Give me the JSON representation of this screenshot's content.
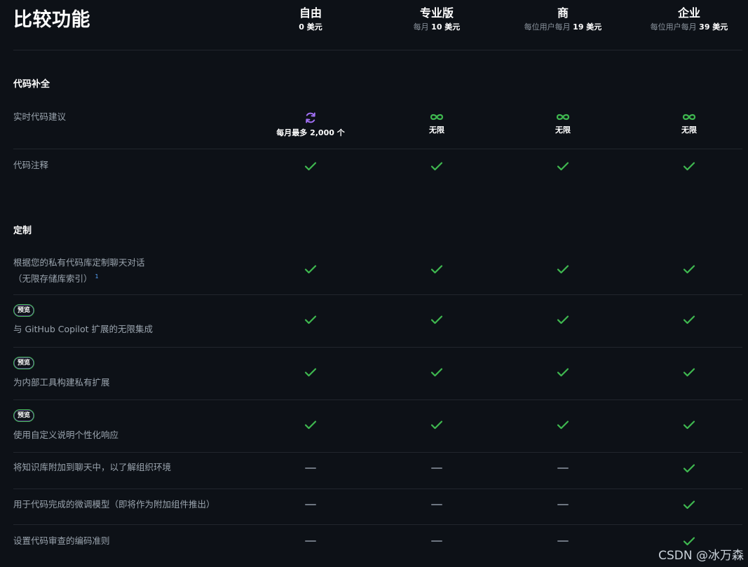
{
  "header": {
    "title": "比较功能",
    "plans": [
      {
        "name": "自由",
        "price_prefix": "",
        "price_value": "0 美元"
      },
      {
        "name": "专业版",
        "price_prefix": "每月 ",
        "price_value": "10 美元"
      },
      {
        "name": "商",
        "price_prefix": "每位用户每月 ",
        "price_value": "19 美元"
      },
      {
        "name": "企业",
        "price_prefix": "每位用户每月 ",
        "price_value": "39 美元"
      }
    ]
  },
  "sections": [
    {
      "title": "代码补全",
      "rows": [
        {
          "label": "实时代码建议",
          "cells": [
            {
              "icon": "refresh-icon",
              "text": "每月最多 2,000 个"
            },
            {
              "icon": "infinity-icon",
              "text": "无限"
            },
            {
              "icon": "infinity-icon",
              "text": "无限"
            },
            {
              "icon": "infinity-icon",
              "text": "无限"
            }
          ]
        },
        {
          "label": "代码注释",
          "cells": [
            "check-icon",
            "check-icon",
            "check-icon",
            "check-icon"
          ]
        }
      ]
    },
    {
      "title": "定制",
      "rows": [
        {
          "label": "根据您的私有代码库定制聊天对话",
          "label_line2": "（无限存储库索引）",
          "footnote": "1",
          "cells": [
            "check-icon",
            "check-icon",
            "check-icon",
            "check-icon"
          ]
        },
        {
          "badge": "预览",
          "label": "与 GitHub Copilot 扩展的无限集成",
          "cells": [
            "check-icon",
            "check-icon",
            "check-icon",
            "check-icon"
          ]
        },
        {
          "badge": "预览",
          "label": "为内部工具构建私有扩展",
          "cells": [
            "check-icon",
            "check-icon",
            "check-icon",
            "check-icon"
          ]
        },
        {
          "badge": "预览",
          "label": "使用自定义说明个性化响应",
          "cells": [
            "check-icon",
            "check-icon",
            "check-icon",
            "check-icon"
          ]
        },
        {
          "label": "将知识库附加到聊天中，以了解组织环境",
          "cells": [
            "dash-icon",
            "dash-icon",
            "dash-icon",
            "check-icon"
          ]
        },
        {
          "label": "用于代码完成的微调模型（即将作为附加组件推出）",
          "cells": [
            "dash-icon",
            "dash-icon",
            "dash-icon",
            "check-icon"
          ]
        },
        {
          "label": "设置代码审查的编码准则",
          "cells": [
            "dash-icon",
            "dash-icon",
            "dash-icon",
            "check-icon"
          ]
        }
      ]
    }
  ],
  "watermark": "CSDN @冰万森",
  "colors": {
    "background": "#0d1117",
    "check": "#3fb950",
    "accent_purple": "#a371f7",
    "divider": "#21262d",
    "dash": "#6e7681"
  }
}
